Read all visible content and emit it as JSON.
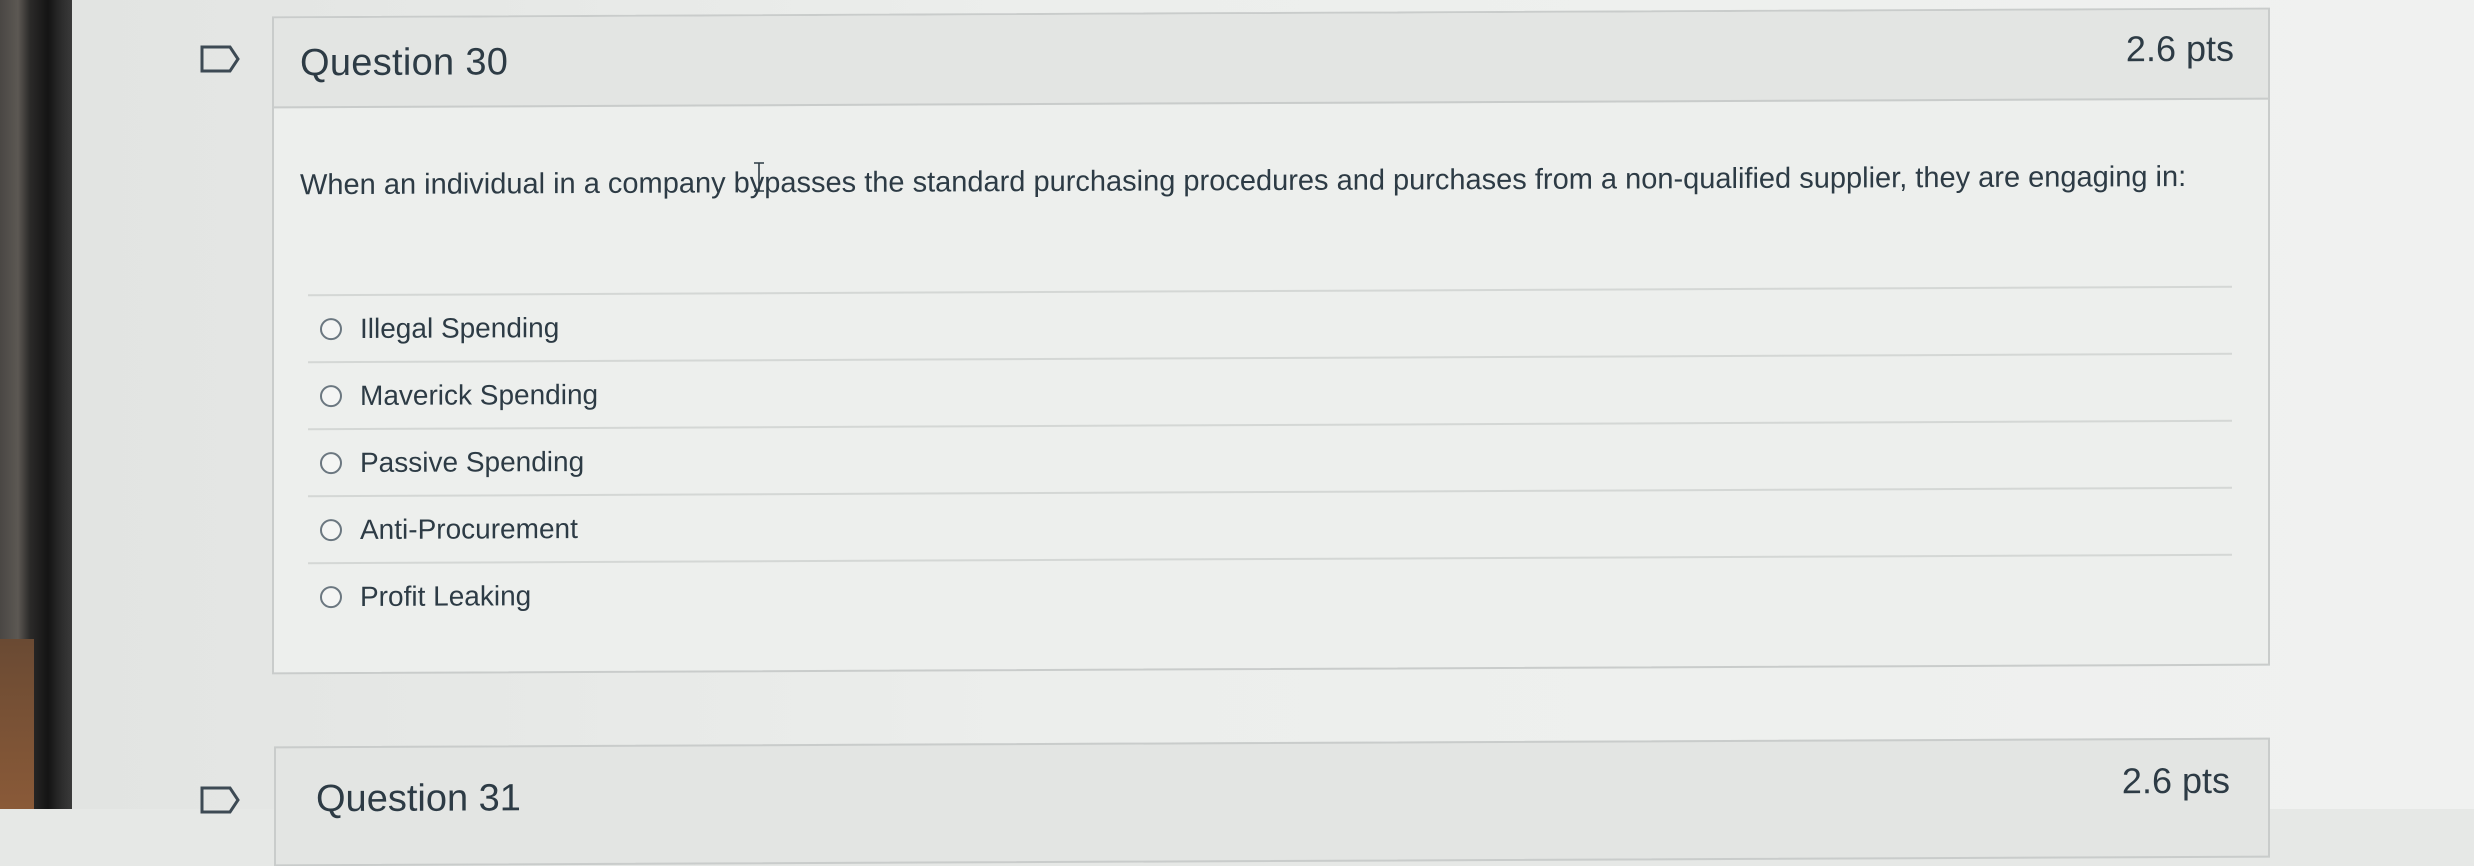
{
  "question_30": {
    "title": "Question 30",
    "points": "2.6 pts",
    "text": "When an individual in a company bypasses the standard purchasing procedures and purchases from a non-qualified supplier, they are engaging in:",
    "answers": [
      {
        "label": "Illegal Spending"
      },
      {
        "label": "Maverick Spending"
      },
      {
        "label": "Passive Spending"
      },
      {
        "label": "Anti-Procurement"
      },
      {
        "label": "Profit Leaking"
      }
    ]
  },
  "question_31": {
    "title": "Question 31",
    "points": "2.6 pts"
  },
  "icons": {
    "flag": "flag-icon",
    "cursor": "text-cursor-icon"
  },
  "colors": {
    "text": "#2d3b45",
    "border": "#c9cccb",
    "header_bg": "#e3e5e3",
    "card_bg": "#edefed"
  }
}
